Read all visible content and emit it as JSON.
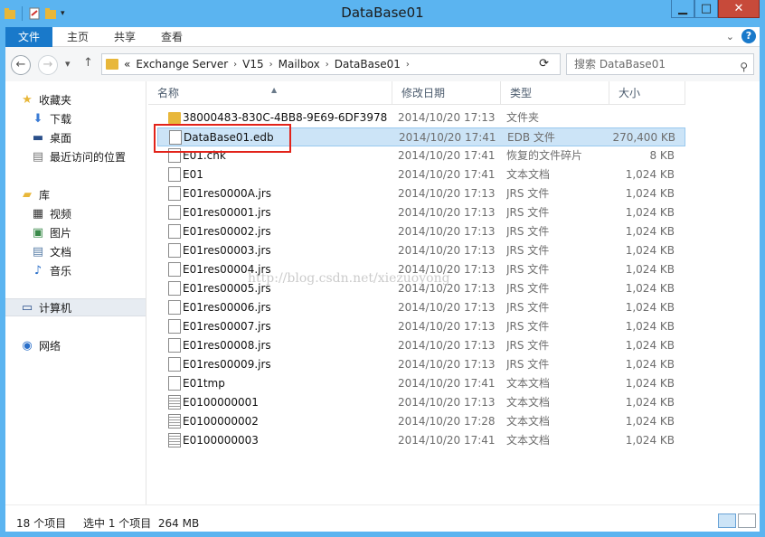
{
  "window": {
    "title": "DataBase01"
  },
  "ribbon": {
    "tabs": [
      "文件",
      "主页",
      "共享",
      "查看"
    ]
  },
  "address": {
    "prefix": "«",
    "segments": [
      "Exchange Server",
      "V15",
      "Mailbox",
      "DataBase01"
    ],
    "search_placeholder": "搜索 DataBase01"
  },
  "sidebar": {
    "favorites": "收藏夹",
    "favorites_items": [
      "下载",
      "桌面",
      "最近访问的位置"
    ],
    "libraries": "库",
    "library_items": [
      "视频",
      "图片",
      "文档",
      "音乐"
    ],
    "computer": "计算机",
    "network": "网络"
  },
  "columns": {
    "name": "名称",
    "date": "修改日期",
    "type": "类型",
    "size": "大小"
  },
  "files": [
    {
      "name": "38000483-830C-4BB8-9E69-6DF3978...",
      "date": "2014/10/20 17:13",
      "type": "文件夹",
      "size": "",
      "icon": "folder-icon"
    },
    {
      "name": "DataBase01.edb",
      "date": "2014/10/20 17:41",
      "type": "EDB 文件",
      "size": "270,400 KB",
      "icon": "file-icon"
    },
    {
      "name": "E01.chk",
      "date": "2014/10/20 17:41",
      "type": "恢复的文件碎片",
      "size": "8 KB",
      "icon": "file-icon"
    },
    {
      "name": "E01",
      "date": "2014/10/20 17:41",
      "type": "文本文档",
      "size": "1,024 KB",
      "icon": "file-icon"
    },
    {
      "name": "E01res0000A.jrs",
      "date": "2014/10/20 17:13",
      "type": "JRS 文件",
      "size": "1,024 KB",
      "icon": "file-icon"
    },
    {
      "name": "E01res00001.jrs",
      "date": "2014/10/20 17:13",
      "type": "JRS 文件",
      "size": "1,024 KB",
      "icon": "file-icon"
    },
    {
      "name": "E01res00002.jrs",
      "date": "2014/10/20 17:13",
      "type": "JRS 文件",
      "size": "1,024 KB",
      "icon": "file-icon"
    },
    {
      "name": "E01res00003.jrs",
      "date": "2014/10/20 17:13",
      "type": "JRS 文件",
      "size": "1,024 KB",
      "icon": "file-icon"
    },
    {
      "name": "E01res00004.jrs",
      "date": "2014/10/20 17:13",
      "type": "JRS 文件",
      "size": "1,024 KB",
      "icon": "file-icon"
    },
    {
      "name": "E01res00005.jrs",
      "date": "2014/10/20 17:13",
      "type": "JRS 文件",
      "size": "1,024 KB",
      "icon": "file-icon"
    },
    {
      "name": "E01res00006.jrs",
      "date": "2014/10/20 17:13",
      "type": "JRS 文件",
      "size": "1,024 KB",
      "icon": "file-icon"
    },
    {
      "name": "E01res00007.jrs",
      "date": "2014/10/20 17:13",
      "type": "JRS 文件",
      "size": "1,024 KB",
      "icon": "file-icon"
    },
    {
      "name": "E01res00008.jrs",
      "date": "2014/10/20 17:13",
      "type": "JRS 文件",
      "size": "1,024 KB",
      "icon": "file-icon"
    },
    {
      "name": "E01res00009.jrs",
      "date": "2014/10/20 17:13",
      "type": "JRS 文件",
      "size": "1,024 KB",
      "icon": "file-icon"
    },
    {
      "name": "E01tmp",
      "date": "2014/10/20 17:41",
      "type": "文本文档",
      "size": "1,024 KB",
      "icon": "file-icon"
    },
    {
      "name": "E0100000001",
      "date": "2014/10/20 17:13",
      "type": "文本文档",
      "size": "1,024 KB",
      "icon": "text-file-icon"
    },
    {
      "name": "E0100000002",
      "date": "2014/10/20 17:28",
      "type": "文本文档",
      "size": "1,024 KB",
      "icon": "text-file-icon"
    },
    {
      "name": "E0100000003",
      "date": "2014/10/20 17:41",
      "type": "文本文档",
      "size": "1,024 KB",
      "icon": "text-file-icon"
    }
  ],
  "selected_file": "DataBase01.edb",
  "watermark": "http://blog.csdn.net/xiezuoyong",
  "status": {
    "count": "18 个项目",
    "selected": "选中 1 个项目  264 MB"
  },
  "colors": {
    "frame": "#5bb4f0",
    "file_tab": "#1979ca",
    "selection": "#cce4f7",
    "highlight_box": "#e2231a"
  }
}
